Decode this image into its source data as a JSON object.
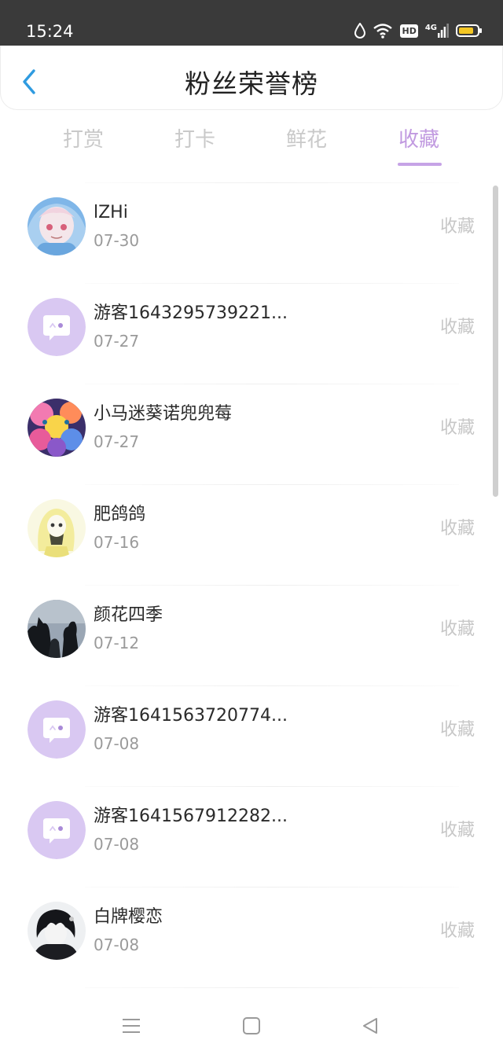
{
  "status_bar": {
    "time": "15:24",
    "icons": [
      "water-drop-icon",
      "wifi-icon",
      "hd-icon",
      "signal-4g-icon",
      "battery-icon"
    ],
    "hd_label": "HD",
    "network_label": "4G",
    "battery_level": 0.8
  },
  "header": {
    "back_icon": "chevron-left-icon",
    "title": "粉丝荣誉榜",
    "accent_color": "#2f9be0"
  },
  "tabs": {
    "items": [
      {
        "label": "打赏",
        "active": false
      },
      {
        "label": "打卡",
        "active": false
      },
      {
        "label": "鲜花",
        "active": false
      },
      {
        "label": "收藏",
        "active": true
      }
    ],
    "active_color": "#c19ae0"
  },
  "fans": [
    {
      "name": "lZHi",
      "date": "07-30",
      "action": "收藏",
      "avatar": "anime-girl-avatar"
    },
    {
      "name": "游客1643295739221...",
      "date": "07-27",
      "action": "收藏",
      "avatar": "default-guest-avatar"
    },
    {
      "name": "小马迷葵诺兜兜莓",
      "date": "07-27",
      "action": "收藏",
      "avatar": "ponies-avatar"
    },
    {
      "name": "肥鸽鸽",
      "date": "07-16",
      "action": "收藏",
      "avatar": "hooded-figure-avatar"
    },
    {
      "name": "颜花四季",
      "date": "07-12",
      "action": "收藏",
      "avatar": "silhouette-avatar"
    },
    {
      "name": "游客1641563720774...",
      "date": "07-08",
      "action": "收藏",
      "avatar": "default-guest-avatar"
    },
    {
      "name": "游客1641567912282...",
      "date": "07-08",
      "action": "收藏",
      "avatar": "default-guest-avatar"
    },
    {
      "name": "白牌樱恋",
      "date": "07-08",
      "action": "收藏",
      "avatar": "dark-hair-boy-avatar"
    }
  ],
  "nav_bar": {
    "icons": [
      "menu-icon",
      "home-square-icon",
      "back-triangle-icon"
    ]
  }
}
